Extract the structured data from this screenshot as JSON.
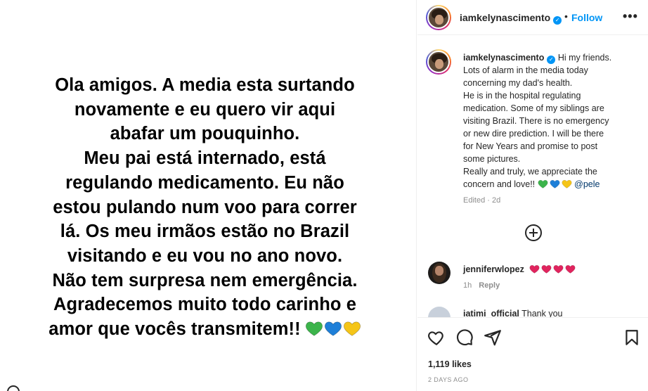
{
  "media": {
    "lines": [
      "Ola amigos. A media esta surtando",
      "novamente e eu quero vir aqui",
      "abafar um pouquinho.",
      "Meu pai está internado, está",
      "regulando medicamento. Eu não",
      "estou pulando num voo para correr",
      "lá. Os meu irmãos estão no Brazil",
      "visitando e eu vou no ano novo.",
      "Não tem surpresa nem emergência.",
      "Agradecemos muito todo carinho e",
      "amor que vocês transmitem!!"
    ],
    "hearts": [
      "#3cb44b",
      "#1e7fd8",
      "#f5c518"
    ]
  },
  "header": {
    "username": "iamkelynascimento",
    "verified_mark": "✓",
    "separator": "•",
    "follow_label": "Follow",
    "more_label": "•••"
  },
  "caption": {
    "username": "iamkelynascimento",
    "first_line": "Hi my friends.",
    "lines": [
      "Lots of alarm in the media today",
      "concerning my dad's health.",
      "He is in the hospital regulating",
      "medication. Some of my siblings are",
      "visiting Brazil. There is no emergency",
      "or new dire prediction. I will be there",
      "for New Years and promise to post",
      "some pictures.",
      "Really and truly, we appreciate the"
    ],
    "last_line": "concern and love!!",
    "hearts": [
      "#3cb44b",
      "#1e7fd8",
      "#f5c518"
    ],
    "mention": "@pele",
    "edited": "Edited · 2d"
  },
  "comments": [
    {
      "username": "jenniferwlopez",
      "hearts": [
        "#e0245e",
        "#e0245e",
        "#e0245e",
        "#e0245e"
      ],
      "time": "1h",
      "reply_label": "Reply"
    },
    {
      "username": "iatimi_official",
      "text": "Thank you"
    }
  ],
  "footer": {
    "likes": "1,119 likes",
    "date": "2 DAYS AGO"
  }
}
